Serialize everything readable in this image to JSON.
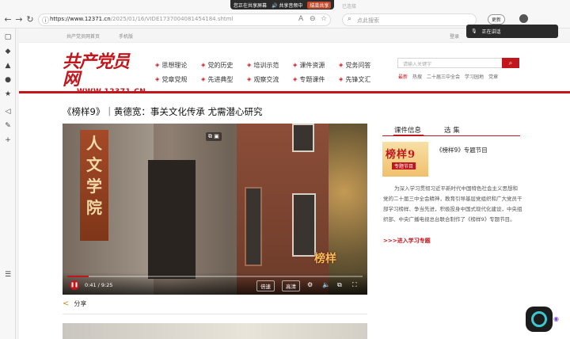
{
  "browser": {
    "share_bar": {
      "current_tab": "您正在共享屏幕",
      "sharing": "共享音频中",
      "stop": "结束共享"
    },
    "ghost_tab": "已连接",
    "url": {
      "domain": "https://www.12371.cn",
      "path": "/2025/01/16/VIDE1737004081454184.shtml"
    },
    "search_placeholder": "点此搜索",
    "update_label": "更新",
    "voice_popup": "正在讲话"
  },
  "site": {
    "util_left": "共产党员网首页",
    "util_mobile": "手机版",
    "util_right": "登录",
    "logo_text": "共产党员网",
    "logo_url": "WWW.12371.CN",
    "menu": [
      "思想理论",
      "党的历史",
      "培训示范",
      "课件资源",
      "党务问答",
      "党章党规",
      "先进典型",
      "观察交流",
      "专题课件",
      "先锋文汇"
    ],
    "search_placeholder": "请输入关键字",
    "hot_words": [
      "最新",
      "热搜",
      "二十届三中全会",
      "学习园地",
      "党章"
    ]
  },
  "article": {
    "title": "《榜样9》｜黄德宽：事关文化传承 尤需潜心研究",
    "video": {
      "sign_text": "人文学院",
      "watermark": "榜样",
      "time": "0:41 / 9:25",
      "progress": 0.073,
      "speed_label": "倍速",
      "quality_label": "高清"
    },
    "share_label": "分享"
  },
  "sidebar_panel": {
    "tabs": [
      "课件信息",
      "选 集"
    ],
    "thumb_title": "榜样9",
    "thumb_sub": "专题节目",
    "item_title": "《榜样9》专题节目",
    "description": "为深入学习贯彻习近平新时代中国特色社会主义思想和党的二十届三中全会精神，教育引导基层党组织和广大党员干部学习榜样、争当先进，积极投身中国式现代化建设，中央组织部、中央广播电视总台联合制作了《榜样9》专题节目。",
    "link": ">>>进入学习专题"
  },
  "colors": {
    "brand": "#c3161c"
  }
}
